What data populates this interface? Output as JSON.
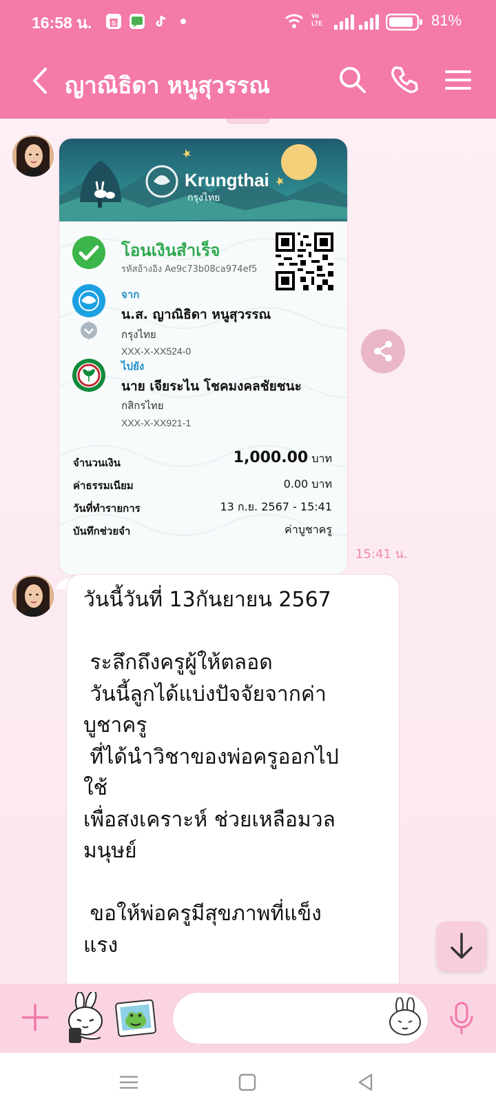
{
  "status_bar": {
    "time": "16:58 น.",
    "battery_percent": "81%",
    "icons": [
      "shopee-icon",
      "chat-icon",
      "tiktok-icon",
      "dot-icon",
      "wifi-icon",
      "volte-icon",
      "signal-icon",
      "signal-icon",
      "battery-icon"
    ],
    "volte_label": "VoLTE"
  },
  "header": {
    "title": "ญาณิธิดา หนูสุวรรณ",
    "icons": [
      "back-icon",
      "search-icon",
      "phone-icon",
      "menu-icon"
    ]
  },
  "slip": {
    "bank_name": "Krungthai",
    "bank_name_th": "กรุงไทย",
    "status": "โอนเงินสำเร็จ",
    "reference": "รหัสอ้างอิง Ae9c73b08ca974ef5",
    "from_label": "จาก",
    "from_name": "น.ส. ญาณิธิดา หนูสุวรรณ",
    "from_bank": "กรุงไทย",
    "from_account": "XXX-X-XX524-0",
    "to_label": "ไปยัง",
    "to_name": "นาย เจียระไน โชคมงคลชัยชนะ",
    "to_bank": "กสิกรไทย",
    "to_account": "XXX-X-XX921-1",
    "amount_label": "จำนวนเงิน",
    "amount_value": "1,000.00",
    "amount_unit": "บาท",
    "fee_label": "ค่าธรรมเนียม",
    "fee_value": "0.00 บาท",
    "date_label": "วันที่ทำรายการ",
    "date_value": "13 ก.ย. 2567 - 15:41",
    "memo_label": "บันทึกช่วยจำ",
    "memo_value": "ค่าบูชาครู"
  },
  "slip_timestamp": "15:41 น.",
  "message": {
    "text": "วันนี้วันที่ 13กันยายน 2567\n\n ระลึกถึงครูผู้ให้ตลอด\n วันนี้ลูกได้แบ่งปัจจัยจากค่า\nบูชาครู\n ที่ได้นำวิชาของพ่อครูออกไป\nใช้\nเพื่อสงเคราะห์ ช่วยเหลือมวล\nมนุษย์\n\n ขอให้พ่อครูมีสุขภาพที่แข็ง\nแรง"
  },
  "input_bar": {
    "placeholder": "",
    "icons": [
      "plus-icon",
      "sticker-icon",
      "image-icon",
      "emoji-icon",
      "mic-icon"
    ]
  },
  "nav_bar": {
    "icons": [
      "recent-apps-icon",
      "home-icon",
      "back-nav-icon"
    ]
  },
  "colors": {
    "header_pink": "#f47aa8",
    "chat_bg": "#fdeff5",
    "success_green": "#2fa84f",
    "link_blue": "#1d8ec9",
    "timestamp_pink": "#f08aae"
  }
}
